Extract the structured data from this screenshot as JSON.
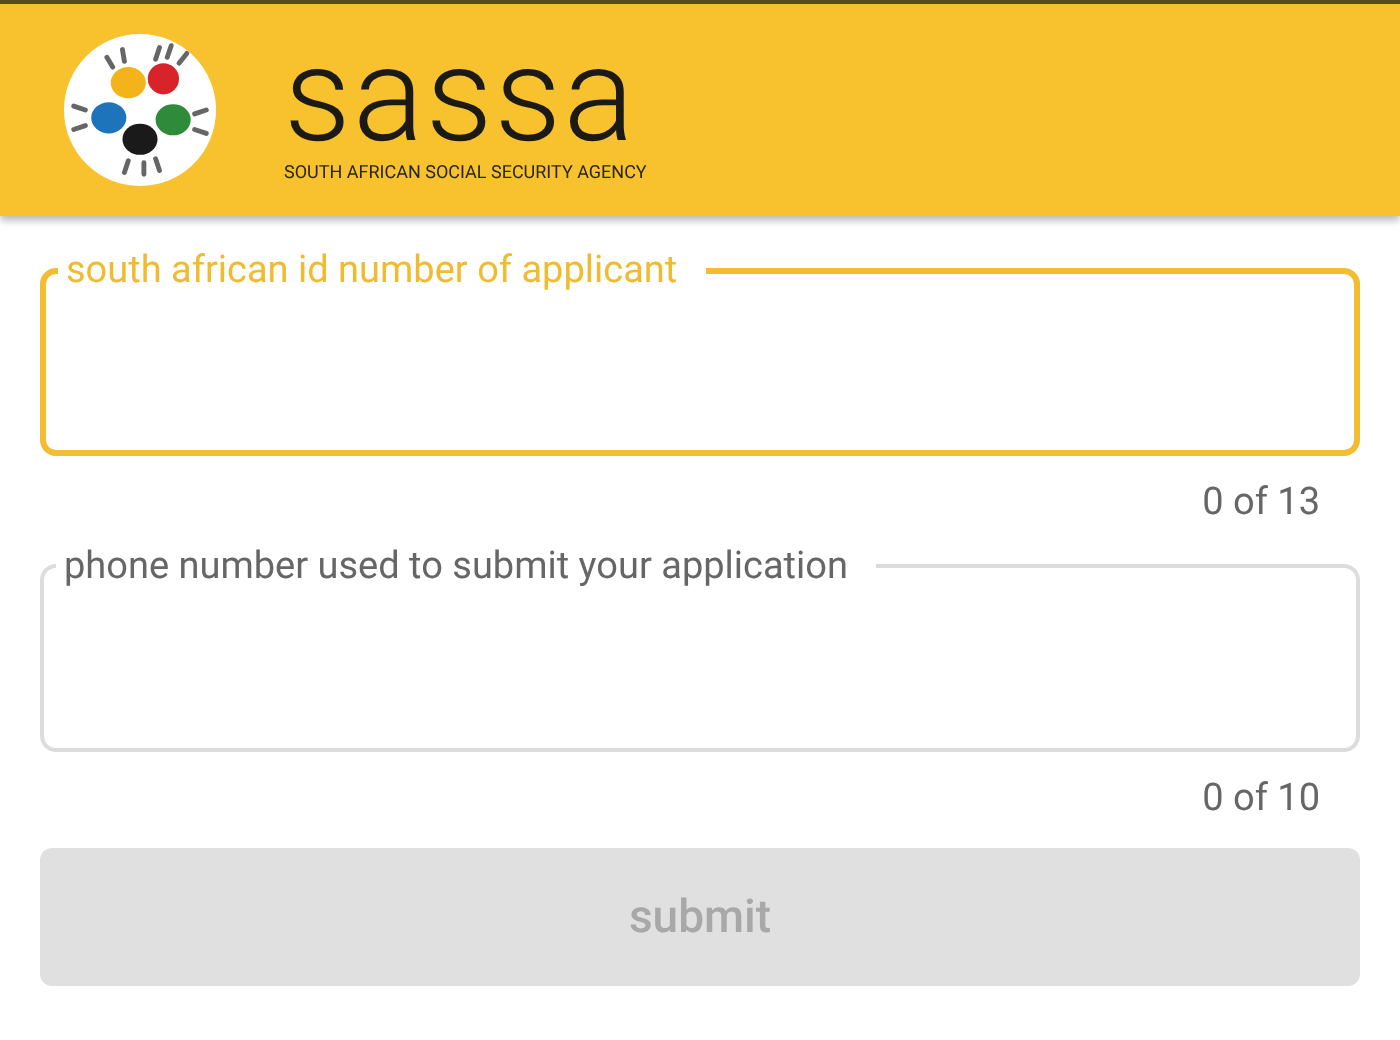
{
  "header": {
    "brand": "sassa",
    "tagline": "SOUTH AFRICAN SOCIAL SECURITY AGENCY"
  },
  "fields": [
    {
      "label": "south african id number of applicant",
      "focused": true,
      "counter": "0 of 13"
    },
    {
      "label": "phone number used to submit your application",
      "focused": false,
      "counter": "0 of 10"
    }
  ],
  "submit": {
    "label": "submit",
    "disabled": true
  }
}
